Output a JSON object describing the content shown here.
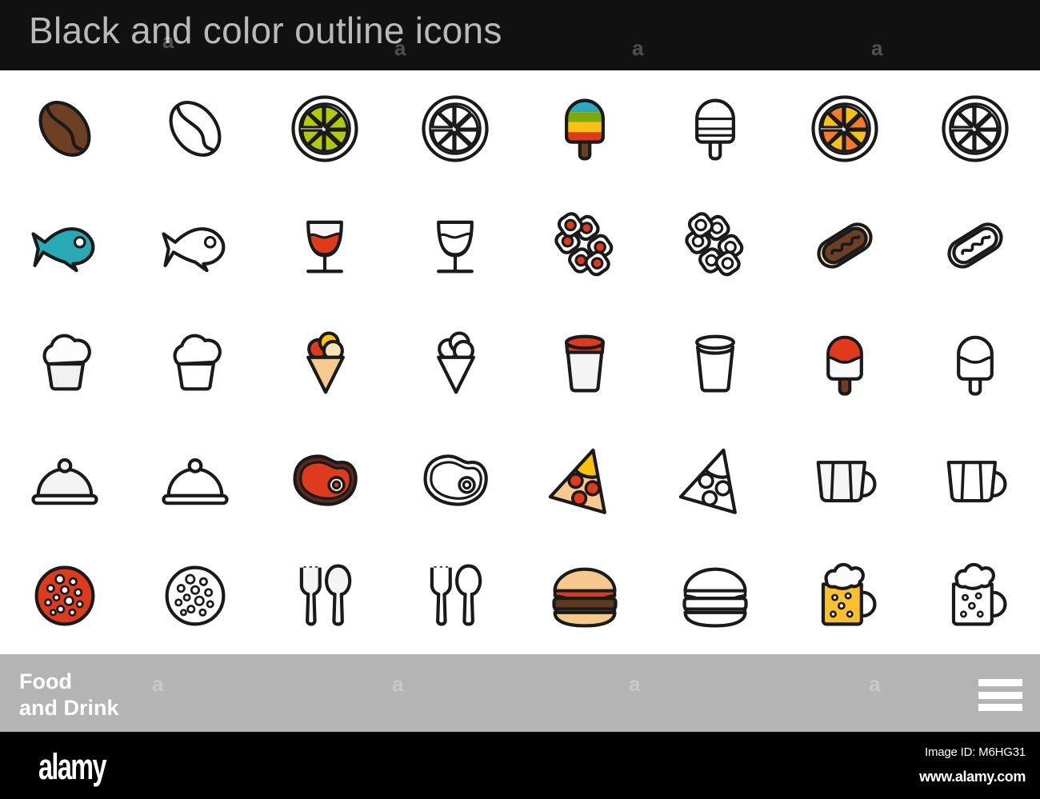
{
  "header": {
    "title": "Black and color outline icons",
    "background_color": "#111111",
    "text_color": "#b9b9b9",
    "watermark_char": "a"
  },
  "footer": {
    "category_line1": "Food",
    "category_line2": "and Drink",
    "background_color": "#b4b4b4",
    "text_color": "#ffffff",
    "menu_label": "menu",
    "watermark_char": "a"
  },
  "stock_bar": {
    "logo": "alamy",
    "image_id": "Image ID: M6HG31",
    "url": "www.alamy.com",
    "background_color": "#000000"
  },
  "palette": {
    "stroke": "#1a1a1a",
    "fill_light": "#f2f2f2",
    "coffee_brown": "#6d4024",
    "lime_green": "#b2c90c",
    "orange": "#f47b2a",
    "amber": "#fcbf14",
    "teal": "#27aab5",
    "red": "#dd3b1c",
    "dark_red": "#5c2a1d",
    "tan": "#f6c98e",
    "cream": "#fbe3b2",
    "beer_gold": "#fbc02d",
    "lettuce_green": "#8cc63e",
    "patty_brown": "#5d3a20",
    "bun_tan": "#f5c98b",
    "pizza_crust": "#fcc10b",
    "sky_blue": "#2aa8c4",
    "grass_green": "#7fa909"
  },
  "grid": {
    "rows": 5,
    "columns": 8,
    "pattern": "alternating color / outline pairs",
    "icons": [
      {
        "id": "coffee-bean-color",
        "label": "Coffee bean",
        "style": "color",
        "row": 1,
        "col": 1
      },
      {
        "id": "coffee-bean-outline",
        "label": "Coffee bean",
        "style": "outline",
        "row": 1,
        "col": 2
      },
      {
        "id": "lime-slice-color",
        "label": "Lime slice",
        "style": "color",
        "row": 1,
        "col": 3
      },
      {
        "id": "lime-slice-outline",
        "label": "Lime slice",
        "style": "outline",
        "row": 1,
        "col": 4
      },
      {
        "id": "popsicle-color",
        "label": "Rainbow popsicle",
        "style": "color",
        "row": 1,
        "col": 5
      },
      {
        "id": "popsicle-outline",
        "label": "Rainbow popsicle",
        "style": "outline",
        "row": 1,
        "col": 6
      },
      {
        "id": "orange-slice-color",
        "label": "Orange slice",
        "style": "color",
        "row": 1,
        "col": 7
      },
      {
        "id": "orange-slice-outline",
        "label": "Orange slice",
        "style": "outline",
        "row": 1,
        "col": 8
      },
      {
        "id": "fish-color",
        "label": "Fish",
        "style": "color",
        "row": 2,
        "col": 1
      },
      {
        "id": "fish-outline",
        "label": "Fish",
        "style": "outline",
        "row": 2,
        "col": 2
      },
      {
        "id": "wine-glass-color",
        "label": "Glass of red wine",
        "style": "color",
        "row": 2,
        "col": 3
      },
      {
        "id": "wine-glass-outline",
        "label": "Glass of red wine",
        "style": "outline",
        "row": 2,
        "col": 4
      },
      {
        "id": "sushi-color",
        "label": "Sushi rolls",
        "style": "color",
        "row": 2,
        "col": 5
      },
      {
        "id": "sushi-outline",
        "label": "Sushi rolls",
        "style": "outline",
        "row": 2,
        "col": 6
      },
      {
        "id": "hot-dog-color",
        "label": "Hot dog",
        "style": "color",
        "row": 2,
        "col": 7
      },
      {
        "id": "hot-dog-outline",
        "label": "Hot dog",
        "style": "outline",
        "row": 2,
        "col": 8
      },
      {
        "id": "cupcake-color",
        "label": "Cupcake",
        "style": "color",
        "row": 3,
        "col": 1
      },
      {
        "id": "cupcake-outline",
        "label": "Cupcake",
        "style": "outline",
        "row": 3,
        "col": 2
      },
      {
        "id": "ice-cream-cone-color",
        "label": "Ice cream cone",
        "style": "color",
        "row": 3,
        "col": 3
      },
      {
        "id": "ice-cream-cone-outline",
        "label": "Ice cream cone",
        "style": "outline",
        "row": 3,
        "col": 4
      },
      {
        "id": "yogurt-cup-color",
        "label": "Yogurt cup",
        "style": "color",
        "row": 3,
        "col": 5
      },
      {
        "id": "yogurt-cup-outline",
        "label": "Yogurt cup",
        "style": "outline",
        "row": 3,
        "col": 6
      },
      {
        "id": "ice-cream-bar-color",
        "label": "Ice cream bar",
        "style": "color",
        "row": 3,
        "col": 7
      },
      {
        "id": "ice-cream-bar-outline",
        "label": "Ice cream bar",
        "style": "outline",
        "row": 3,
        "col": 8
      },
      {
        "id": "cloche-color",
        "label": "Serving dome",
        "style": "color",
        "row": 4,
        "col": 1
      },
      {
        "id": "cloche-outline",
        "label": "Serving dome",
        "style": "outline",
        "row": 4,
        "col": 2
      },
      {
        "id": "steak-color",
        "label": "Steak",
        "style": "color",
        "row": 4,
        "col": 3
      },
      {
        "id": "steak-outline",
        "label": "Steak",
        "style": "outline",
        "row": 4,
        "col": 4
      },
      {
        "id": "pizza-slice-color",
        "label": "Pizza slice",
        "style": "color",
        "row": 4,
        "col": 5
      },
      {
        "id": "pizza-slice-outline",
        "label": "Pizza slice",
        "style": "outline",
        "row": 4,
        "col": 6
      },
      {
        "id": "coffee-cup-color",
        "label": "Coffee cup",
        "style": "color",
        "row": 4,
        "col": 7
      },
      {
        "id": "coffee-cup-outline",
        "label": "Coffee cup",
        "style": "outline",
        "row": 4,
        "col": 8
      },
      {
        "id": "salami-color",
        "label": "Salami slice",
        "style": "color",
        "row": 5,
        "col": 1
      },
      {
        "id": "salami-outline",
        "label": "Salami slice",
        "style": "outline",
        "row": 5,
        "col": 2
      },
      {
        "id": "cutlery-color",
        "label": "Fork and spoon",
        "style": "color",
        "row": 5,
        "col": 3
      },
      {
        "id": "cutlery-outline",
        "label": "Fork and spoon",
        "style": "outline",
        "row": 5,
        "col": 4
      },
      {
        "id": "hamburger-color",
        "label": "Hamburger",
        "style": "color",
        "row": 5,
        "col": 5
      },
      {
        "id": "hamburger-outline",
        "label": "Hamburger",
        "style": "outline",
        "row": 5,
        "col": 6
      },
      {
        "id": "beer-mug-color",
        "label": "Beer mug",
        "style": "color",
        "row": 5,
        "col": 7
      },
      {
        "id": "beer-mug-outline",
        "label": "Beer mug",
        "style": "outline",
        "row": 5,
        "col": 8
      }
    ]
  }
}
